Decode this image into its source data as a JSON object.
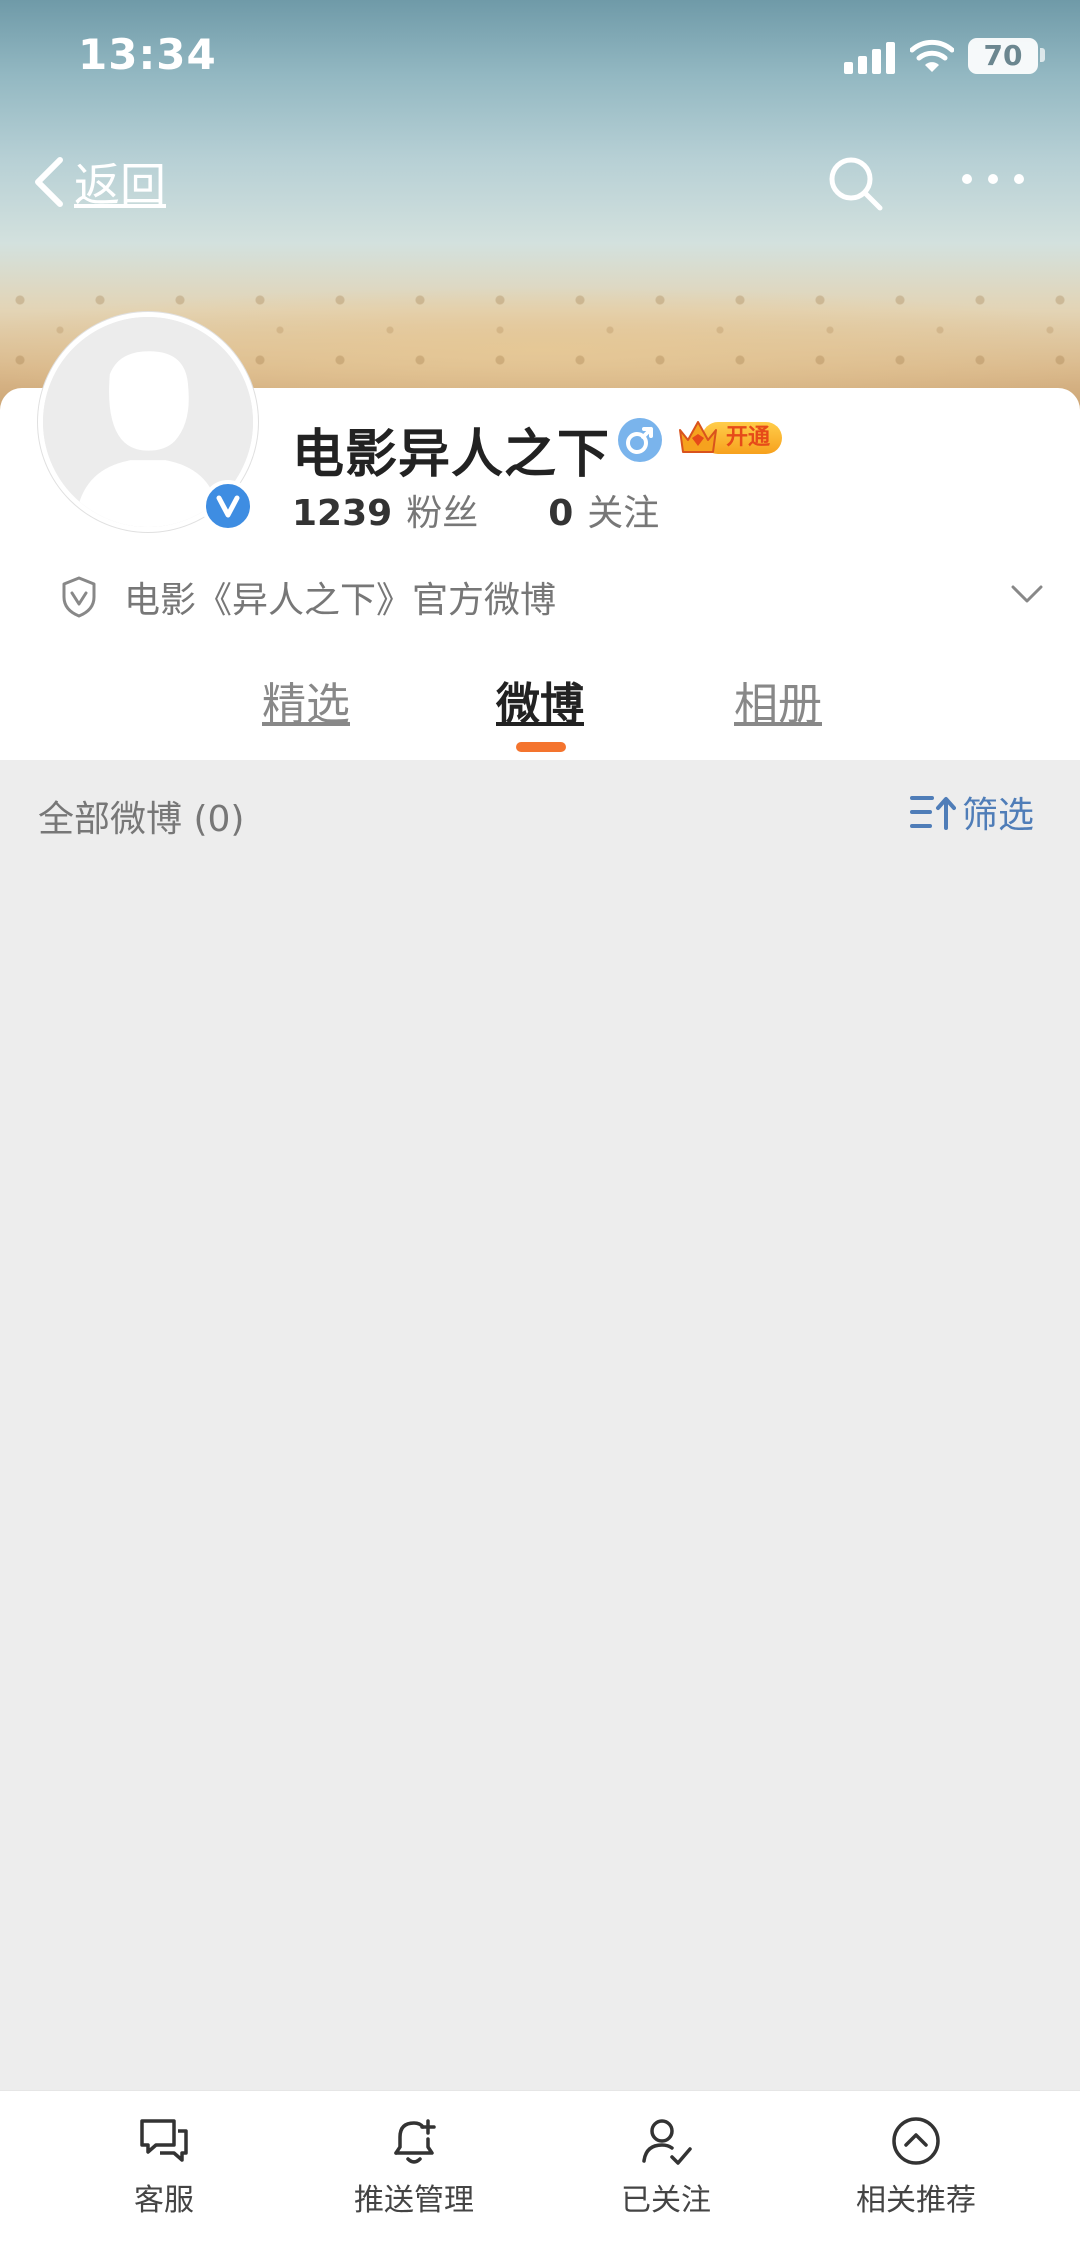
{
  "status_bar": {
    "time": "13:34",
    "battery": "70"
  },
  "nav": {
    "back_label": "返回"
  },
  "profile": {
    "name": "电影异人之下",
    "vip_label": "开通",
    "followers_count": "1239",
    "followers_label": "粉丝",
    "following_count": "0",
    "following_label": "关注",
    "description": "电影《异人之下》官方微博"
  },
  "tabs": [
    {
      "label": "精选",
      "active": false
    },
    {
      "label": "微博",
      "active": true
    },
    {
      "label": "相册",
      "active": false
    }
  ],
  "feed": {
    "title": "全部微博 (0)",
    "filter_label": "筛选"
  },
  "bottom_bar": [
    {
      "label": "客服",
      "icon": "chat-bubbles-icon"
    },
    {
      "label": "推送管理",
      "icon": "bell-plus-icon"
    },
    {
      "label": "已关注",
      "icon": "user-check-icon"
    },
    {
      "label": "相关推荐",
      "icon": "chevron-up-circle-icon"
    }
  ],
  "colors": {
    "accent": "#f4742e",
    "link_blue": "#4f7db8",
    "verified_blue": "#3e8de2",
    "background": "#ededed"
  }
}
